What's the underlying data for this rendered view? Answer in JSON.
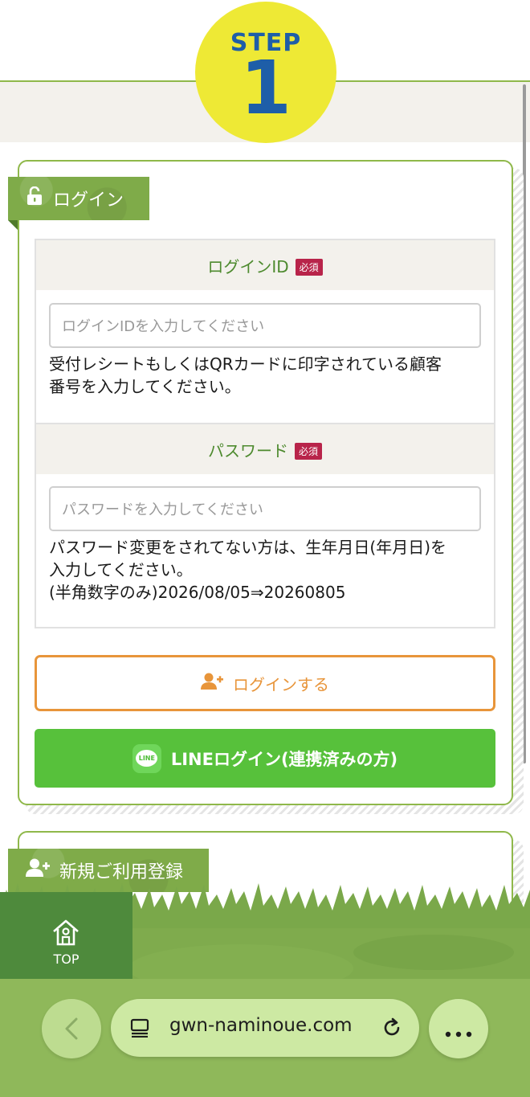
{
  "step": {
    "word": "STEP",
    "number": "1"
  },
  "login_card": {
    "tag_label": "ログイン",
    "login_id": {
      "label": "ログインID",
      "required": "必須",
      "placeholder": "ログインIDを入力してください",
      "note_line1": "受付レシートもしくはQRカードに印字されている顧客",
      "note_line2": "番号を入力してください。"
    },
    "password": {
      "label": "パスワード",
      "required": "必須",
      "placeholder": "パスワードを入力してください",
      "note_line1": "パスワード変更をされてない方は、生年月日(年月日)を",
      "note_line2": "入力してください。",
      "note_line3": "(半角数字のみ)2026/08/05⇒20260805"
    },
    "login_button": "ログインする",
    "line_button": "LINEログイン(連携済みの方)",
    "line_logo_text": "LINE"
  },
  "register_card": {
    "tag_label": "新規ご利用登録"
  },
  "top_button": {
    "label": "TOP"
  },
  "browser": {
    "url": "gwn-naminoue.com"
  },
  "colors": {
    "accent_green": "#8fb84a",
    "step_yellow": "#eee935",
    "step_blue": "#1e5ea8",
    "login_orange": "#e8953a",
    "line_green": "#57c13b",
    "required_red": "#b8244a"
  },
  "icons": [
    "unlock-icon",
    "add-user-icon",
    "line-logo-icon",
    "home-icon",
    "back-arrow-icon",
    "tabs-icon",
    "reload-icon",
    "more-icon"
  ]
}
